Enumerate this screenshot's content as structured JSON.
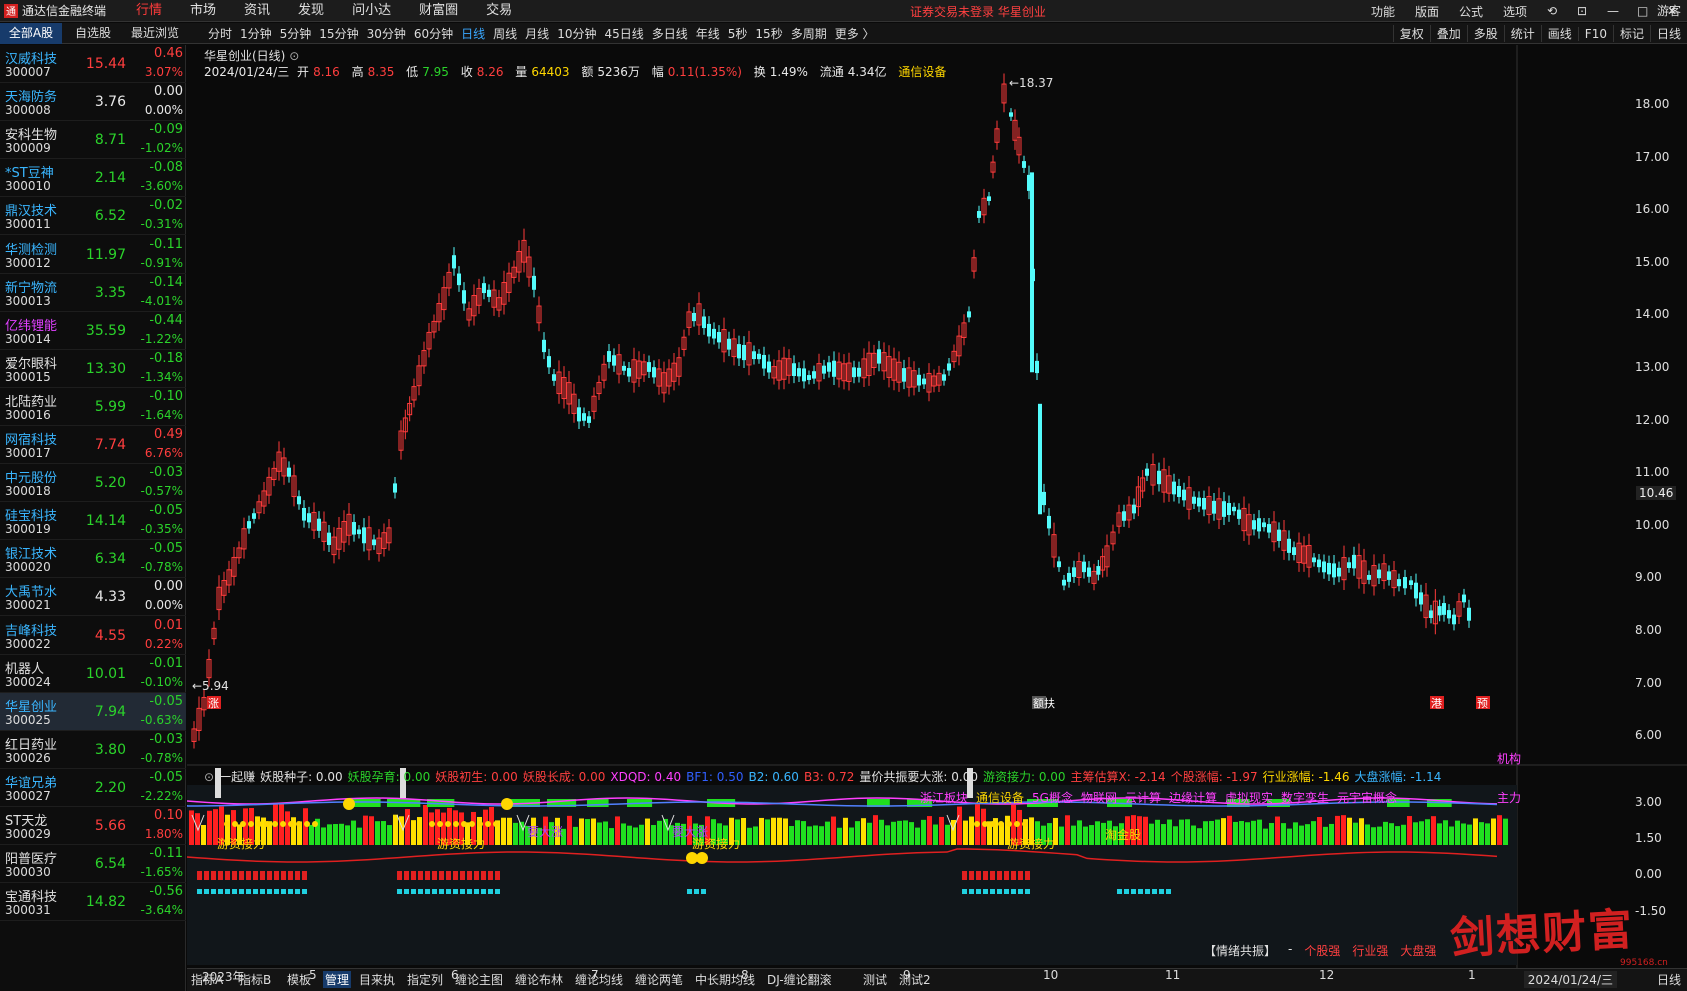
{
  "app": {
    "title": "通达信金融终端",
    "notice": "证券交易未登录 华星创业",
    "menu": [
      "行情",
      "市场",
      "资讯",
      "发现",
      "问小达",
      "财富圈",
      "交易"
    ],
    "active_menu": "行情",
    "right_menu": [
      "功能",
      "版面",
      "公式",
      "选项"
    ],
    "guest": "游客",
    "win_buttons": [
      "—",
      "□",
      "✕"
    ]
  },
  "subtabs": [
    "全部A股",
    "自选股",
    "最近浏览"
  ],
  "periods": [
    "分时",
    "1分钟",
    "5分钟",
    "15分钟",
    "30分钟",
    "60分钟",
    "日线",
    "周线",
    "月线",
    "10分钟",
    "45日线",
    "多日线",
    "年线",
    "5秒",
    "15秒",
    "多周期",
    "更多 〉"
  ],
  "active_period": "日线",
  "tools": [
    "复权",
    "叠加",
    "多股",
    "统计",
    "画线",
    "F10",
    "标记",
    "日线"
  ],
  "stocks": [
    {
      "name": "汉威科技",
      "code": "300007",
      "price": "15.44",
      "chg": "0.46",
      "pct": "3.07%",
      "dir": "red",
      "name_color": "#3ab6ff"
    },
    {
      "name": "天海防务",
      "code": "300008",
      "price": "3.76",
      "chg": "0.00",
      "pct": "0.00%",
      "dir": "white",
      "name_color": "#3ab6ff"
    },
    {
      "name": "安科生物",
      "code": "300009",
      "price": "8.71",
      "chg": "-0.09",
      "pct": "-1.02%",
      "dir": "green",
      "name_color": "#e0e0e0"
    },
    {
      "name": "*ST豆神",
      "code": "300010",
      "price": "2.14",
      "chg": "-0.08",
      "pct": "-3.60%",
      "dir": "green",
      "name_color": "#3ab6ff"
    },
    {
      "name": "鼎汉技术",
      "code": "300011",
      "price": "6.52",
      "chg": "-0.02",
      "pct": "-0.31%",
      "dir": "green",
      "name_color": "#3ab6ff"
    },
    {
      "name": "华测检测",
      "code": "300012",
      "price": "11.97",
      "chg": "-0.11",
      "pct": "-0.91%",
      "dir": "green",
      "name_color": "#3ab6ff"
    },
    {
      "name": "新宁物流",
      "code": "300013",
      "price": "3.35",
      "chg": "-0.14",
      "pct": "-4.01%",
      "dir": "green",
      "name_color": "#3ab6ff"
    },
    {
      "name": "亿纬锂能",
      "code": "300014",
      "price": "35.59",
      "chg": "-0.44",
      "pct": "-1.22%",
      "dir": "green",
      "name_color": "#e040ff"
    },
    {
      "name": "爱尔眼科",
      "code": "300015",
      "price": "13.30",
      "chg": "-0.18",
      "pct": "-1.34%",
      "dir": "green",
      "name_color": "#e0e0e0"
    },
    {
      "name": "北陆药业",
      "code": "300016",
      "price": "5.99",
      "chg": "-0.10",
      "pct": "-1.64%",
      "dir": "green",
      "name_color": "#e0e0e0"
    },
    {
      "name": "网宿科技",
      "code": "300017",
      "price": "7.74",
      "chg": "0.49",
      "pct": "6.76%",
      "dir": "red",
      "name_color": "#3ab6ff"
    },
    {
      "name": "中元股份",
      "code": "300018",
      "price": "5.20",
      "chg": "-0.03",
      "pct": "-0.57%",
      "dir": "green",
      "name_color": "#3ab6ff"
    },
    {
      "name": "硅宝科技",
      "code": "300019",
      "price": "14.14",
      "chg": "-0.05",
      "pct": "-0.35%",
      "dir": "green",
      "name_color": "#3ab6ff"
    },
    {
      "name": "银江技术",
      "code": "300020",
      "price": "6.34",
      "chg": "-0.05",
      "pct": "-0.78%",
      "dir": "green",
      "name_color": "#3ab6ff"
    },
    {
      "name": "大禹节水",
      "code": "300021",
      "price": "4.33",
      "chg": "0.00",
      "pct": "0.00%",
      "dir": "white",
      "name_color": "#3ab6ff"
    },
    {
      "name": "吉峰科技",
      "code": "300022",
      "price": "4.55",
      "chg": "0.01",
      "pct": "0.22%",
      "dir": "red",
      "name_color": "#3ab6ff"
    },
    {
      "name": "机器人",
      "code": "300024",
      "price": "10.01",
      "chg": "-0.01",
      "pct": "-0.10%",
      "dir": "green",
      "name_color": "#e0e0e0"
    },
    {
      "name": "华星创业",
      "code": "300025",
      "price": "7.94",
      "chg": "-0.05",
      "pct": "-0.63%",
      "dir": "green",
      "name_color": "#3ab6ff"
    },
    {
      "name": "红日药业",
      "code": "300026",
      "price": "3.80",
      "chg": "-0.03",
      "pct": "-0.78%",
      "dir": "green",
      "name_color": "#e0e0e0"
    },
    {
      "name": "华谊兄弟",
      "code": "300027",
      "price": "2.20",
      "chg": "-0.05",
      "pct": "-2.22%",
      "dir": "green",
      "name_color": "#3ab6ff"
    },
    {
      "name": "ST天龙",
      "code": "300029",
      "price": "5.66",
      "chg": "0.10",
      "pct": "1.80%",
      "dir": "red",
      "name_color": "#e0e0e0"
    },
    {
      "name": "阳普医疗",
      "code": "300030",
      "price": "6.54",
      "chg": "-0.11",
      "pct": "-1.65%",
      "dir": "green",
      "name_color": "#e0e0e0"
    },
    {
      "name": "宝通科技",
      "code": "300031",
      "price": "14.82",
      "chg": "-0.56",
      "pct": "-3.64%",
      "dir": "green",
      "name_color": "#e0e0e0"
    }
  ],
  "chart_header": {
    "title": "华星创业(日线)",
    "date": "2024/01/24/三",
    "open_label": "开",
    "open": "8.16",
    "high_label": "高",
    "high": "8.35",
    "low_label": "低",
    "low": "7.95",
    "close_label": "收",
    "close": "8.26",
    "vol_label": "量",
    "vol": "64403",
    "amt_label": "额",
    "amt": "5236万",
    "amp_label": "幅",
    "amp": "0.11(1.35%)",
    "turn_label": "换",
    "turn": "1.49%",
    "float_label": "流通",
    "float": "4.34亿",
    "sector": "通信设备"
  },
  "price_axis": {
    "ticks": [
      "18.00",
      "17.00",
      "16.00",
      "15.00",
      "14.00",
      "13.00",
      "12.00",
      "11.00",
      "10.00",
      "9.00",
      "8.00",
      "7.00",
      "6.00"
    ],
    "current": "10.46",
    "max_label": "18.37",
    "min_label": "5.94"
  },
  "chart_markers": {
    "start": "涨",
    "mid": "额扶",
    "end1": "港",
    "end2": "预"
  },
  "indicator": {
    "items": [
      {
        "t": "一起赚",
        "c": "#e0e0e0"
      },
      {
        "t": "妖股种子: 0.00",
        "c": "#e0e0e0"
      },
      {
        "t": "妖股孕育: 0.00",
        "c": "#2bd32b"
      },
      {
        "t": "妖股初生: 0.00",
        "c": "#ff4040"
      },
      {
        "t": "妖股长成: 0.00",
        "c": "#ff4040"
      },
      {
        "t": "XDQD: 0.40",
        "c": "#ff40ff"
      },
      {
        "t": "BF1: 0.50",
        "c": "#3060ff"
      },
      {
        "t": "B2: 0.60",
        "c": "#3ab6ff"
      },
      {
        "t": "B3: 0.72",
        "c": "#ff4040"
      },
      {
        "t": "量价共振要大涨: 0.00",
        "c": "#e0e0e0"
      },
      {
        "t": "游资接力: 0.00",
        "c": "#2bd32b"
      },
      {
        "t": "主筹估算X: -2.14",
        "c": "#ff4040"
      },
      {
        "t": "个股涨幅: -1.97",
        "c": "#ff4040"
      },
      {
        "t": "行业涨幅: -1.46",
        "c": "#ffd700"
      },
      {
        "t": "大盘涨幅: -1.14",
        "c": "#3ab6ff"
      }
    ],
    "concepts": [
      {
        "t": "浙江板块",
        "c": "#ff40ff"
      },
      {
        "t": "通信设备",
        "c": "#ffd700"
      },
      {
        "t": "5G概念",
        "c": "#ff40ff"
      },
      {
        "t": "物联网",
        "c": "#ff40ff"
      },
      {
        "t": "云计算",
        "c": "#ff40ff"
      },
      {
        "t": "边缘计算",
        "c": "#ff40ff"
      },
      {
        "t": "虚拟现实",
        "c": "#ff40ff"
      },
      {
        "t": "数字孪生",
        "c": "#ff40ff"
      },
      {
        "t": "元宇宙概念",
        "c": "#ff40ff"
      }
    ],
    "ticks": [
      "3.00",
      "1.50",
      "0.00",
      "-1.50"
    ],
    "signals": {
      "yzjl": "游资接力",
      "ydz": "要大涨",
      "tjg": "淘金股",
      "jg": "机构",
      "zl": "主力"
    },
    "mood": {
      "title": "【情绪共振】",
      "dash": "-",
      "a": "个股强",
      "b": "行业强",
      "c": "大盘强"
    }
  },
  "x_labels": [
    {
      "t": "2023年",
      "x": 202
    },
    {
      "t": "5",
      "x": 309
    },
    {
      "t": "6",
      "x": 451
    },
    {
      "t": "7",
      "x": 591
    },
    {
      "t": "8",
      "x": 741
    },
    {
      "t": "9",
      "x": 903
    },
    {
      "t": "10",
      "x": 1043
    },
    {
      "t": "11",
      "x": 1165
    },
    {
      "t": "12",
      "x": 1319
    },
    {
      "t": "1",
      "x": 1468
    }
  ],
  "bottom_tabs": [
    "指标A",
    "指标B",
    "模板",
    "管理",
    "目来执",
    "指定列",
    "缠论主图",
    "缠论布林",
    "缠论均线",
    "缠论两笔",
    "中长期均线",
    "DJ-缠论翻滚",
    "测试",
    "测试2"
  ],
  "bottom_date": "2024/01/24/三",
  "watermark": "剑想财富",
  "watermark_sub": "995168.cn",
  "chart_data": {
    "type": "candlestick",
    "title": "华星创业(日线)",
    "y_range": [
      5.8,
      18.6
    ],
    "x_range": [
      "2023-01",
      "2024-01"
    ],
    "key_points": [
      {
        "date": "2023-01-03",
        "price": 5.94,
        "note": "low"
      },
      {
        "date": "2023-10-19",
        "price": 18.37,
        "note": "high"
      },
      {
        "date": "2024-01-24",
        "open": 8.16,
        "high": 8.35,
        "low": 7.95,
        "close": 8.26
      }
    ]
  }
}
